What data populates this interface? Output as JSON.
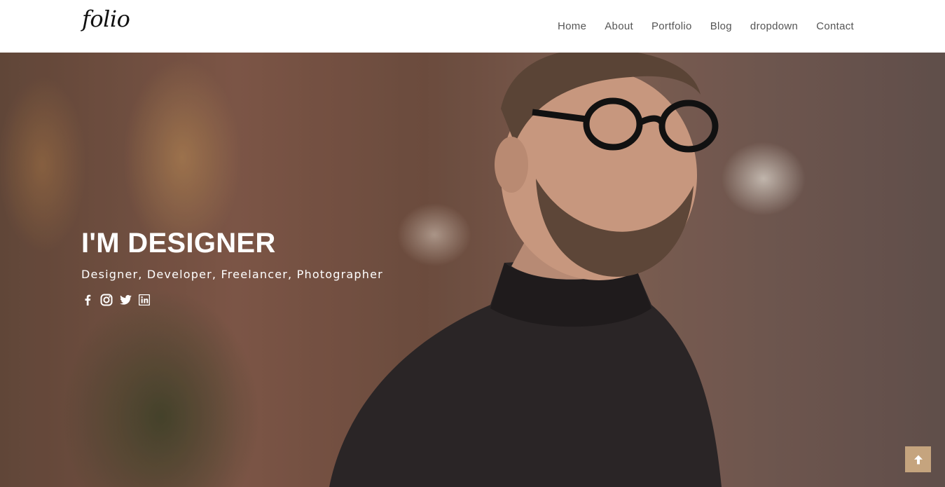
{
  "brand": {
    "logo_text": "folio"
  },
  "nav": {
    "items": [
      {
        "label": "Home"
      },
      {
        "label": "About"
      },
      {
        "label": "Portfolio"
      },
      {
        "label": "Blog"
      },
      {
        "label": "dropdown"
      },
      {
        "label": "Contact"
      }
    ]
  },
  "hero": {
    "title": "I'M DESIGNER",
    "subtitle": "Designer, Developer, Freelancer, Photographer",
    "social_icons": [
      "facebook-icon",
      "instagram-icon",
      "twitter-icon",
      "linkedin-icon"
    ]
  },
  "back_to_top": {
    "icon": "arrow-up-icon"
  },
  "colors": {
    "accent": "#c5a47e",
    "nav_text": "#555555",
    "hero_text": "#ffffff"
  }
}
